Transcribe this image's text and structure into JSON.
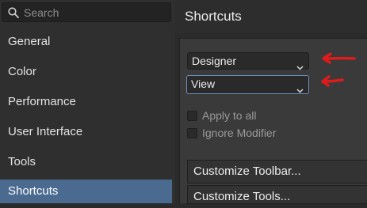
{
  "sidebar": {
    "search_placeholder": "Search",
    "items": [
      {
        "label": "General"
      },
      {
        "label": "Color"
      },
      {
        "label": "Performance"
      },
      {
        "label": "User Interface"
      },
      {
        "label": "Tools"
      },
      {
        "label": "Shortcuts",
        "active": true
      }
    ]
  },
  "header": {
    "title": "Shortcuts"
  },
  "shortcuts": {
    "persona_select": "Designer",
    "category_select": "View",
    "apply_to_all_label": "Apply to all",
    "ignore_modifier_label": "Ignore Modifier",
    "customize_toolbar_label": "Customize Toolbar...",
    "customize_tools_label": "Customize Tools..."
  },
  "annotations": {
    "arrow_color": "#e01b1b"
  },
  "colors": {
    "accent": "#4a6a90",
    "focus_border": "#6a8fbf"
  }
}
